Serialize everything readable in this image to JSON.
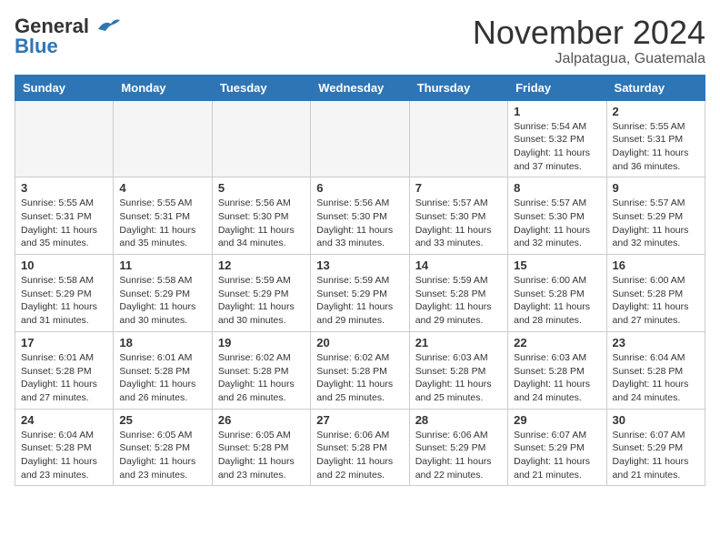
{
  "header": {
    "logo_general": "General",
    "logo_blue": "Blue",
    "month": "November 2024",
    "location": "Jalpatagua, Guatemala"
  },
  "weekdays": [
    "Sunday",
    "Monday",
    "Tuesday",
    "Wednesday",
    "Thursday",
    "Friday",
    "Saturday"
  ],
  "weeks": [
    [
      {
        "day": "",
        "info": ""
      },
      {
        "day": "",
        "info": ""
      },
      {
        "day": "",
        "info": ""
      },
      {
        "day": "",
        "info": ""
      },
      {
        "day": "",
        "info": ""
      },
      {
        "day": "1",
        "info": "Sunrise: 5:54 AM\nSunset: 5:32 PM\nDaylight: 11 hours and 37 minutes."
      },
      {
        "day": "2",
        "info": "Sunrise: 5:55 AM\nSunset: 5:31 PM\nDaylight: 11 hours and 36 minutes."
      }
    ],
    [
      {
        "day": "3",
        "info": "Sunrise: 5:55 AM\nSunset: 5:31 PM\nDaylight: 11 hours and 35 minutes."
      },
      {
        "day": "4",
        "info": "Sunrise: 5:55 AM\nSunset: 5:31 PM\nDaylight: 11 hours and 35 minutes."
      },
      {
        "day": "5",
        "info": "Sunrise: 5:56 AM\nSunset: 5:30 PM\nDaylight: 11 hours and 34 minutes."
      },
      {
        "day": "6",
        "info": "Sunrise: 5:56 AM\nSunset: 5:30 PM\nDaylight: 11 hours and 33 minutes."
      },
      {
        "day": "7",
        "info": "Sunrise: 5:57 AM\nSunset: 5:30 PM\nDaylight: 11 hours and 33 minutes."
      },
      {
        "day": "8",
        "info": "Sunrise: 5:57 AM\nSunset: 5:30 PM\nDaylight: 11 hours and 32 minutes."
      },
      {
        "day": "9",
        "info": "Sunrise: 5:57 AM\nSunset: 5:29 PM\nDaylight: 11 hours and 32 minutes."
      }
    ],
    [
      {
        "day": "10",
        "info": "Sunrise: 5:58 AM\nSunset: 5:29 PM\nDaylight: 11 hours and 31 minutes."
      },
      {
        "day": "11",
        "info": "Sunrise: 5:58 AM\nSunset: 5:29 PM\nDaylight: 11 hours and 30 minutes."
      },
      {
        "day": "12",
        "info": "Sunrise: 5:59 AM\nSunset: 5:29 PM\nDaylight: 11 hours and 30 minutes."
      },
      {
        "day": "13",
        "info": "Sunrise: 5:59 AM\nSunset: 5:29 PM\nDaylight: 11 hours and 29 minutes."
      },
      {
        "day": "14",
        "info": "Sunrise: 5:59 AM\nSunset: 5:28 PM\nDaylight: 11 hours and 29 minutes."
      },
      {
        "day": "15",
        "info": "Sunrise: 6:00 AM\nSunset: 5:28 PM\nDaylight: 11 hours and 28 minutes."
      },
      {
        "day": "16",
        "info": "Sunrise: 6:00 AM\nSunset: 5:28 PM\nDaylight: 11 hours and 27 minutes."
      }
    ],
    [
      {
        "day": "17",
        "info": "Sunrise: 6:01 AM\nSunset: 5:28 PM\nDaylight: 11 hours and 27 minutes."
      },
      {
        "day": "18",
        "info": "Sunrise: 6:01 AM\nSunset: 5:28 PM\nDaylight: 11 hours and 26 minutes."
      },
      {
        "day": "19",
        "info": "Sunrise: 6:02 AM\nSunset: 5:28 PM\nDaylight: 11 hours and 26 minutes."
      },
      {
        "day": "20",
        "info": "Sunrise: 6:02 AM\nSunset: 5:28 PM\nDaylight: 11 hours and 25 minutes."
      },
      {
        "day": "21",
        "info": "Sunrise: 6:03 AM\nSunset: 5:28 PM\nDaylight: 11 hours and 25 minutes."
      },
      {
        "day": "22",
        "info": "Sunrise: 6:03 AM\nSunset: 5:28 PM\nDaylight: 11 hours and 24 minutes."
      },
      {
        "day": "23",
        "info": "Sunrise: 6:04 AM\nSunset: 5:28 PM\nDaylight: 11 hours and 24 minutes."
      }
    ],
    [
      {
        "day": "24",
        "info": "Sunrise: 6:04 AM\nSunset: 5:28 PM\nDaylight: 11 hours and 23 minutes."
      },
      {
        "day": "25",
        "info": "Sunrise: 6:05 AM\nSunset: 5:28 PM\nDaylight: 11 hours and 23 minutes."
      },
      {
        "day": "26",
        "info": "Sunrise: 6:05 AM\nSunset: 5:28 PM\nDaylight: 11 hours and 23 minutes."
      },
      {
        "day": "27",
        "info": "Sunrise: 6:06 AM\nSunset: 5:28 PM\nDaylight: 11 hours and 22 minutes."
      },
      {
        "day": "28",
        "info": "Sunrise: 6:06 AM\nSunset: 5:29 PM\nDaylight: 11 hours and 22 minutes."
      },
      {
        "day": "29",
        "info": "Sunrise: 6:07 AM\nSunset: 5:29 PM\nDaylight: 11 hours and 21 minutes."
      },
      {
        "day": "30",
        "info": "Sunrise: 6:07 AM\nSunset: 5:29 PM\nDaylight: 11 hours and 21 minutes."
      }
    ]
  ]
}
